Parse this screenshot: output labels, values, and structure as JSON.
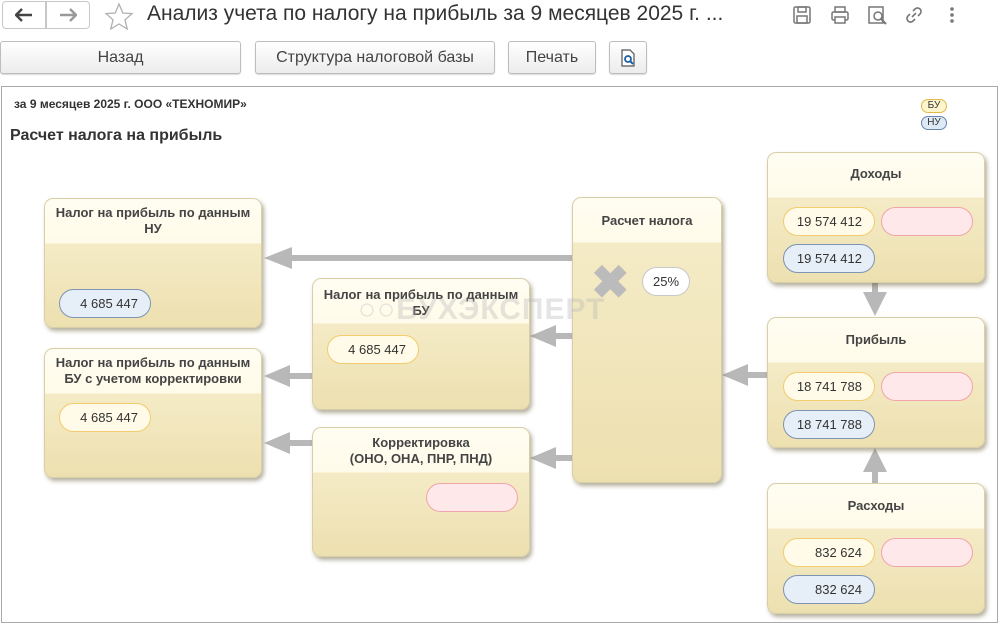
{
  "window": {
    "title": "Анализ учета по налогу на прибыль за 9 месяцев 2025 г. ..."
  },
  "toolbar": {
    "back_label": "Назад",
    "structure_label": "Структура налоговой базы",
    "print_label": "Печать"
  },
  "report": {
    "period": "за 9 месяцев 2025 г. ООО «ТЕХНОМИР»",
    "title": "Расчет налога на прибыль",
    "legend": {
      "bu": "БУ",
      "nu": "НУ"
    },
    "watermark": "БУХЭКСПЕРТ",
    "boxes": {
      "income": {
        "title": "Доходы",
        "bu_value": "19 574 412",
        "nu_value": "19 574 412"
      },
      "profit": {
        "title": "Прибыль",
        "bu_value": "18 741 788",
        "nu_value": "18 741 788"
      },
      "expenses": {
        "title": "Расходы",
        "bu_value": "832 624",
        "nu_value": "832 624"
      },
      "tax_calc": {
        "title": "Расчет налога",
        "rate": "25%"
      },
      "tax_nu": {
        "title": "Налог на прибыль по данным НУ",
        "value": "4 685 447"
      },
      "tax_bu": {
        "title": "Налог на прибыль по данным БУ",
        "value": "4 685 447"
      },
      "tax_bu_adj": {
        "title": "Налог на прибыль по данным БУ с учетом корректировки",
        "value": "4 685 447"
      },
      "adjustment": {
        "title_line1": "Корректировка",
        "title_line2": "(ОНО, ОНА, ПНР, ПНД)"
      }
    }
  },
  "colors": {
    "box_top": "#fffdf2",
    "box_bottom": "#ede0b0",
    "arrow": "#b8b8b8",
    "bu_border": "#f2cc6e",
    "nu_border": "#7d94b4",
    "err_border": "#f0a4ab"
  }
}
